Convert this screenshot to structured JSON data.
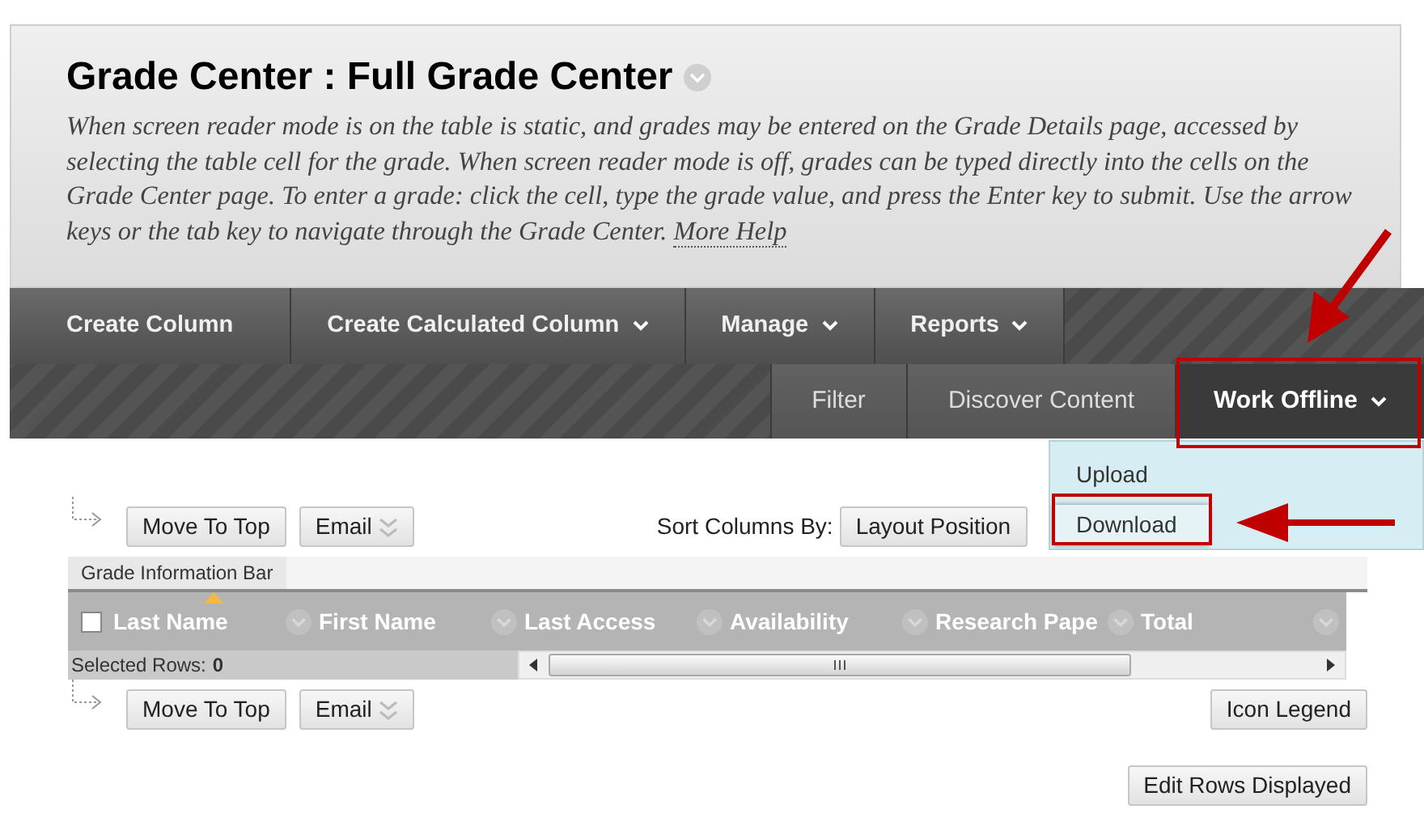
{
  "header": {
    "title": "Grade Center : Full Grade Center",
    "description": "When screen reader mode is on the table is static, and grades may be entered on the Grade Details page, accessed by selecting the table cell for the grade. When screen reader mode is off, grades can be typed directly into the cells on the Grade Center page. To enter a grade: click the cell, type the grade value, and press the Enter key to submit. Use the arrow keys or the tab key to navigate through the Grade Center.",
    "help_link": "More Help"
  },
  "action_bar": {
    "primary": [
      {
        "label": "Create Column",
        "has_menu": false
      },
      {
        "label": "Create Calculated Column",
        "has_menu": true
      },
      {
        "label": "Manage",
        "has_menu": true
      },
      {
        "label": "Reports",
        "has_menu": true
      }
    ],
    "secondary": [
      {
        "label": "Filter",
        "selected": false,
        "has_menu": false
      },
      {
        "label": "Discover Content",
        "selected": false,
        "has_menu": false
      },
      {
        "label": "Work Offline",
        "selected": true,
        "has_menu": true
      }
    ]
  },
  "menu": {
    "items": [
      {
        "label": "Upload",
        "highlighted": false
      },
      {
        "label": "Download",
        "highlighted": true
      }
    ]
  },
  "top_controls": {
    "move_button": "Move To Top",
    "email_button": "Email",
    "sort_label": "Sort Columns By:",
    "sort_value": "Layout Position"
  },
  "grade_info_bar": "Grade Information Bar",
  "table": {
    "select_all_checked": false,
    "columns": [
      "Last Name",
      "First Name",
      "Last Access",
      "Availability",
      "Research Pape",
      "Total"
    ]
  },
  "selection": {
    "label": "Selected Rows:",
    "count": "0"
  },
  "bottom_controls": {
    "move_button": "Move To Top",
    "email_button": "Email",
    "legend_button": "Icon Legend"
  },
  "edit_rows_button": "Edit Rows Displayed"
}
